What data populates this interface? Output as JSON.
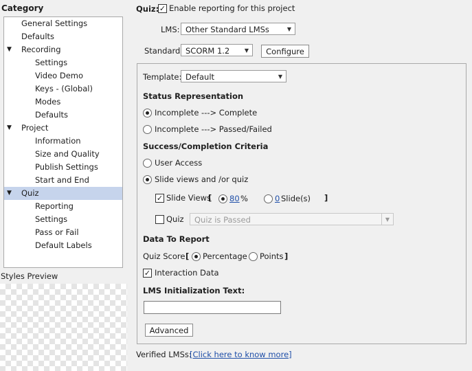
{
  "left": {
    "category_title": "Category",
    "tree": [
      {
        "label": "General Settings",
        "level": 1
      },
      {
        "label": "Defaults",
        "level": 1
      },
      {
        "label": "Recording",
        "level": 0,
        "expanded": true
      },
      {
        "label": "Settings",
        "level": 2
      },
      {
        "label": "Video Demo",
        "level": 2
      },
      {
        "label": "Keys - (Global)",
        "level": 2
      },
      {
        "label": "Modes",
        "level": 2
      },
      {
        "label": "Defaults",
        "level": 2
      },
      {
        "label": "Project",
        "level": 0,
        "expanded": true
      },
      {
        "label": "Information",
        "level": 2
      },
      {
        "label": "Size and Quality",
        "level": 2
      },
      {
        "label": "Publish Settings",
        "level": 2
      },
      {
        "label": "Start and End",
        "level": 2
      },
      {
        "label": "Quiz",
        "level": 0,
        "expanded": true,
        "selected": true
      },
      {
        "label": "Reporting",
        "level": 2
      },
      {
        "label": "Settings",
        "level": 2
      },
      {
        "label": "Pass or Fail",
        "level": 2
      },
      {
        "label": "Default Labels",
        "level": 2
      }
    ],
    "styles_preview_title": "Styles Preview"
  },
  "header": {
    "quiz_label": "Quiz:",
    "enable_reporting_label": "Enable reporting for this project",
    "enable_reporting_checked": true,
    "lms_label": "LMS:",
    "lms_value": "Other Standard LMSs",
    "standard_label": "Standard:",
    "standard_value": "SCORM 1.2",
    "configure_label": "Configure"
  },
  "panel": {
    "template_label": "Template:",
    "template_value": "Default",
    "status_title": "Status Representation",
    "status_option1": "Incomplete ---> Complete",
    "status_option2": "Incomplete ---> Passed/Failed",
    "status_selected": 1,
    "criteria_title": "Success/Completion Criteria",
    "criteria_option1": "User Access",
    "criteria_option2": "Slide views and /or quiz",
    "criteria_selected": 2,
    "slide_views_label": "Slide Views",
    "slide_views_checked": true,
    "bracket_open": "[",
    "bracket_close": "]",
    "percent_value": "80",
    "percent_sign": "%",
    "slides_value": "0",
    "slides_label": "Slide(s)",
    "quiz_label": "Quiz",
    "quiz_checked": false,
    "quiz_dropdown_value": "Quiz is Passed",
    "data_title": "Data To Report",
    "quiz_score_label": "Quiz Score",
    "percentage_label": "Percentage",
    "points_label": "Points",
    "interaction_label": "Interaction Data",
    "interaction_checked": true,
    "lms_init_title": "LMS Initialization Text:",
    "lms_init_value": "",
    "advanced_label": "Advanced"
  },
  "footer": {
    "verified_label": "Verified LMSs:",
    "verified_link": "[Click here to know more]"
  },
  "colors": {
    "selected_row": "#c6d4ec",
    "link": "#1f4fa8",
    "background": "#f0f0f0"
  },
  "icons": {
    "expanded_arrow": "triangle-down-icon",
    "dropdown": "chevron-down-icon"
  }
}
